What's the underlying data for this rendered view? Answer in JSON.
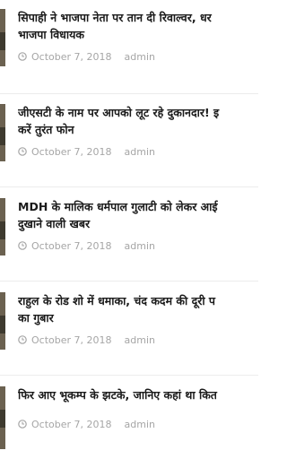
{
  "posts": [
    {
      "title_lines": [
        "सिपाही ने भाजपा नेता पर तान दी रिवाल्वर, धर",
        "भाजपा विधायक"
      ],
      "date": "October 7, 2018",
      "author": "admin",
      "icon": "clock-icon"
    },
    {
      "title_lines": [
        "जीएसटी के नाम पर आपको लूट रहे दुकानदार! इ",
        "करें तुरंत फोन"
      ],
      "date": "October 7, 2018",
      "author": "admin",
      "icon": "clock-icon"
    },
    {
      "title_lines": [
        "MDH के मालिक धर्मपाल गुलाटी को लेकर आई",
        "दुखाने वाली खबर"
      ],
      "date": "October 7, 2018",
      "author": "admin",
      "icon": "clock-icon"
    },
    {
      "title_lines": [
        "राहुल के रोड शो में धमाका, चंद कदम की दूरी प",
        "का गुबार"
      ],
      "date": "October 7, 2018",
      "author": "admin",
      "icon": "clock-icon"
    },
    {
      "title_lines": [
        "फिर आए भूकम्प के झटके, जानिए कहां था कित"
      ],
      "date": "October 7, 2018",
      "author": "admin",
      "icon": "clock-icon"
    }
  ],
  "colors": {
    "title": "#1b1b1b",
    "meta": "#a6a6a6",
    "divider": "#ececec"
  }
}
